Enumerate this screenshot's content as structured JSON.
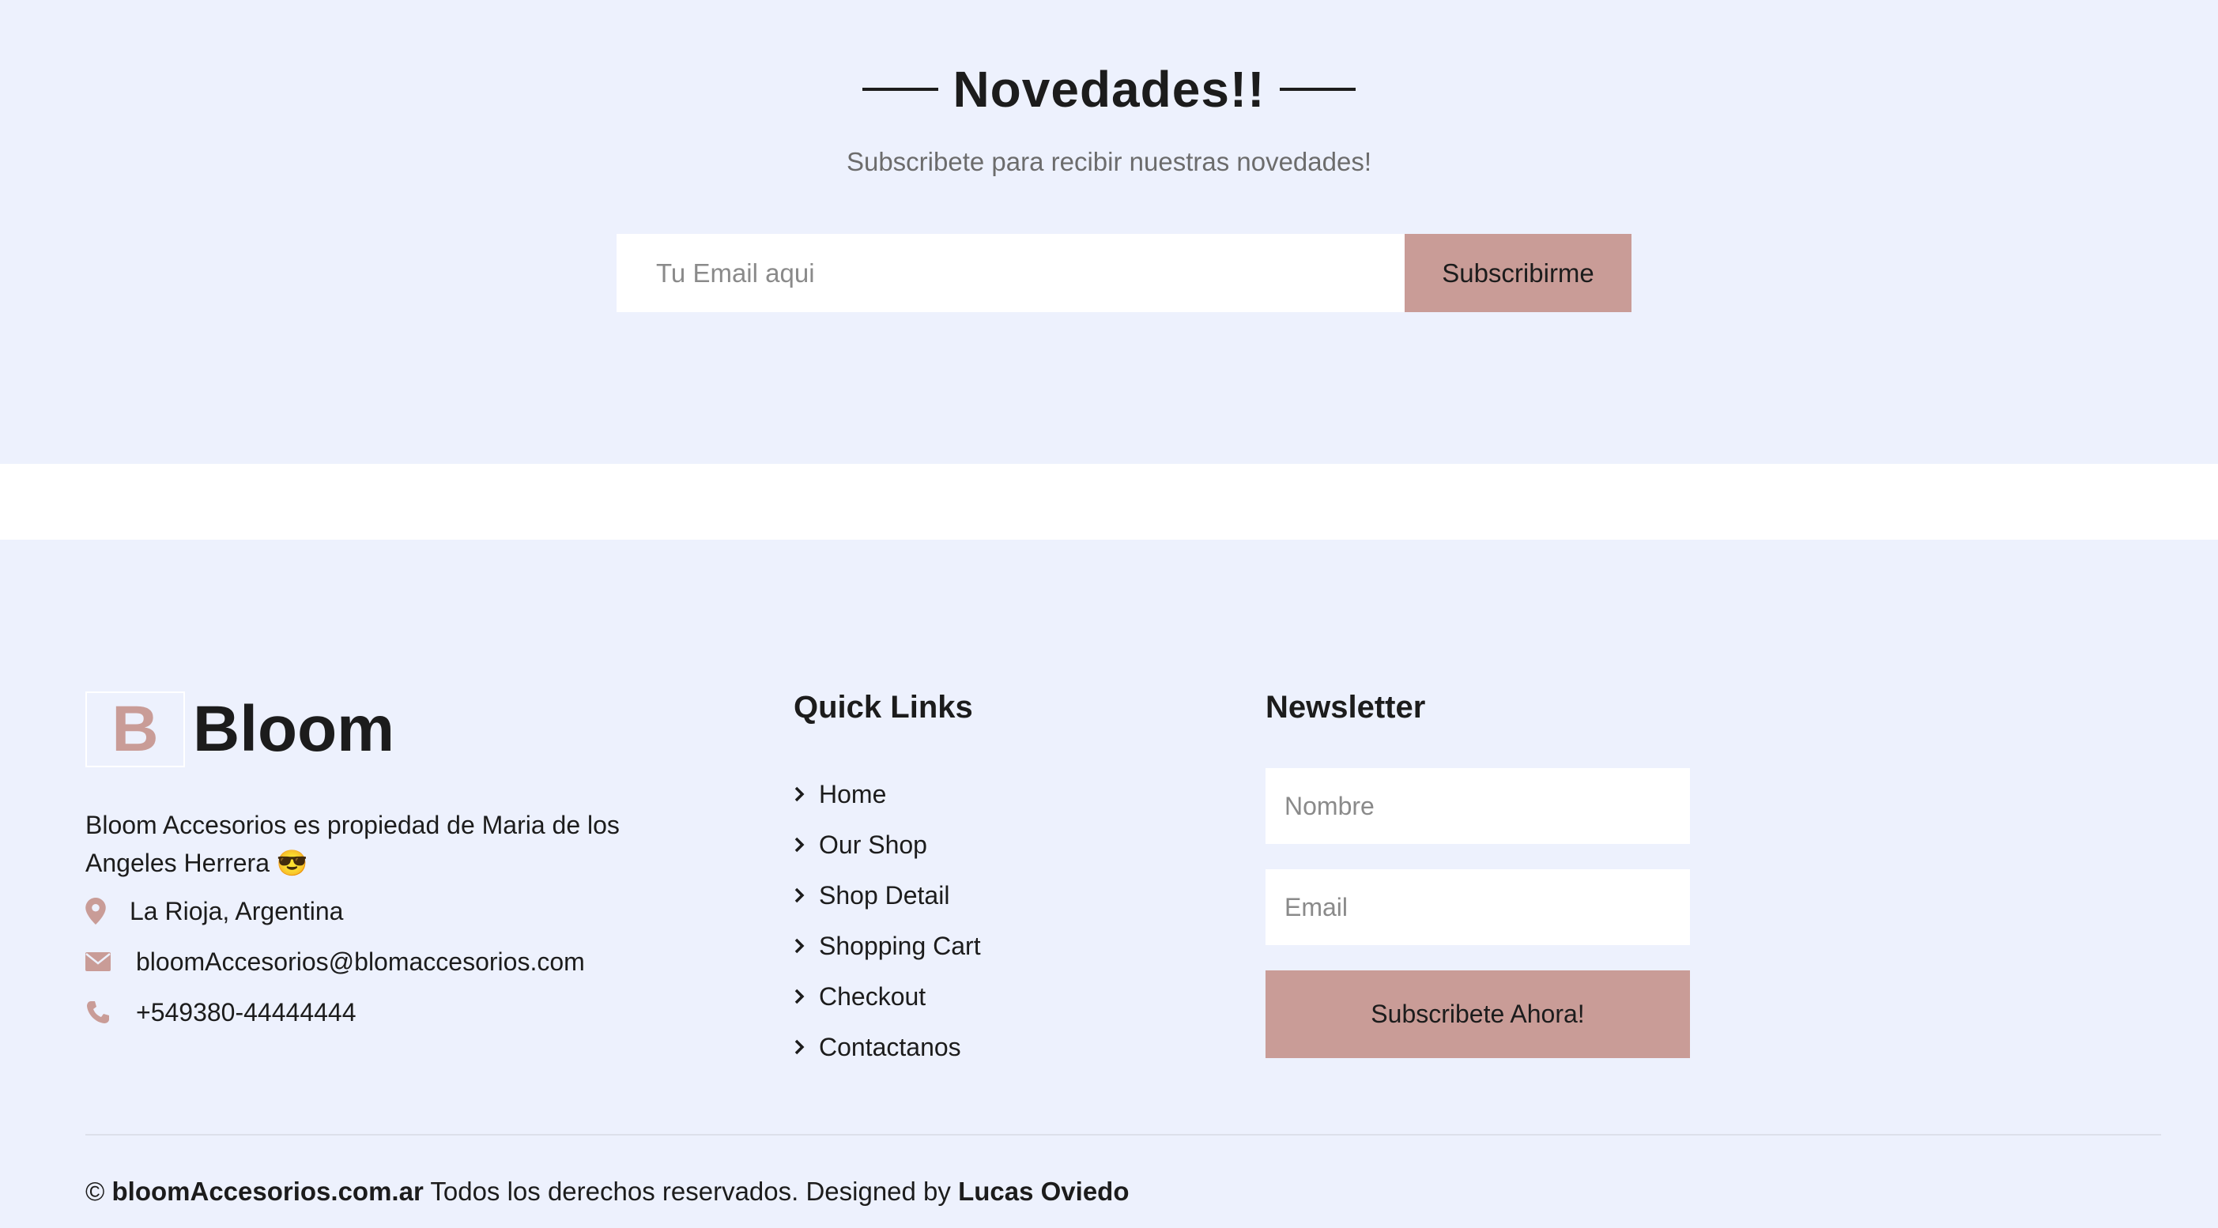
{
  "newsletter_band": {
    "title": "Novedades!!",
    "subtitle": "Subscribete para recibir nuestras novedades!",
    "email_placeholder": "Tu Email aqui",
    "button_label": "Subscribirme"
  },
  "footer": {
    "logo_letter": "B",
    "logo_text": "Bloom",
    "about": "Bloom Accesorios es propiedad de Maria de los Angeles Herrera 😎",
    "contact": {
      "location": "La Rioja, Argentina",
      "location_icon": "map-marker-icon",
      "email": "bloomAccesorios@blomaccesorios.com",
      "email_icon": "envelope-icon",
      "phone": "+549380-44444444",
      "phone_icon": "phone-icon"
    },
    "quick_links": {
      "heading": "Quick Links",
      "items": [
        {
          "label": "Home"
        },
        {
          "label": "Our Shop"
        },
        {
          "label": "Shop Detail"
        },
        {
          "label": "Shopping Cart"
        },
        {
          "label": "Checkout"
        },
        {
          "label": "Contactanos"
        }
      ]
    },
    "newsletter": {
      "heading": "Newsletter",
      "name_placeholder": "Nombre",
      "email_placeholder": "Email",
      "button_label": "Subscribete Ahora!"
    },
    "copyright": {
      "symbol": "©",
      "site": "bloomAccesorios.com.ar",
      "rights": "Todos los derechos reservados. Designed by",
      "designer": "Lucas Oviedo"
    }
  },
  "colors": {
    "background": "#edf1fd",
    "accent": "#c99c97",
    "text": "#1c1c1c"
  }
}
